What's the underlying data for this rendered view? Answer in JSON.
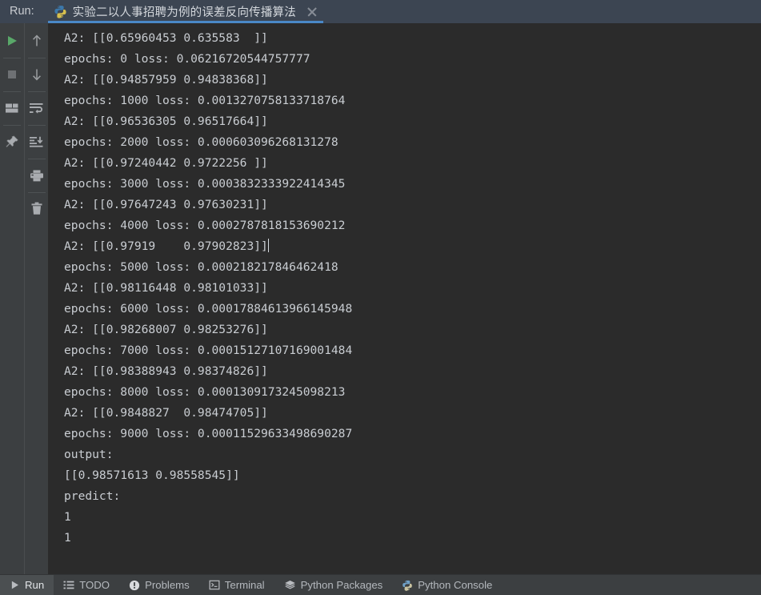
{
  "window": {
    "run_label": "Run:",
    "accent_color": "#4a88c7",
    "titlebar_bg": "#3c4552",
    "console_bg": "#2b2b2b",
    "console_fg": "#c9cdd2",
    "toolbar_bg": "#3c3f41"
  },
  "tab": {
    "title": "实验二以人事招聘为例的误差反向传播算法",
    "icon": "python-icon",
    "close_icon": "close-icon",
    "active": true
  },
  "left_toolbar": {
    "items": [
      {
        "name": "rerun-button",
        "icon": "play-icon",
        "color": "#59a869"
      },
      {
        "name": "stop-button",
        "icon": "stop-icon",
        "color": "#6e7174"
      },
      {
        "name": "layout-button",
        "icon": "layout-icon",
        "color": "#a9acb0"
      },
      {
        "name": "pin-button",
        "icon": "pin-icon",
        "color": "#a9acb0"
      }
    ]
  },
  "right_toolbar": {
    "items": [
      {
        "name": "previous-occurrence-button",
        "icon": "arrow-up-icon"
      },
      {
        "name": "next-occurrence-button",
        "icon": "arrow-down-icon"
      },
      {
        "name": "soft-wrap-button",
        "icon": "soft-wrap-icon"
      },
      {
        "name": "scroll-to-end-button",
        "icon": "scroll-to-end-icon"
      },
      {
        "name": "print-button",
        "icon": "print-icon"
      },
      {
        "name": "clear-all-button",
        "icon": "trash-icon"
      }
    ]
  },
  "console": {
    "lines": [
      "A2: [[0.65960453 0.635583  ]]",
      "epochs: 0 loss: 0.06216720544757777",
      "A2: [[0.94857959 0.94838368]]",
      "epochs: 1000 loss: 0.0013270758133718764",
      "A2: [[0.96536305 0.96517664]]",
      "epochs: 2000 loss: 0.000603096268131278",
      "A2: [[0.97240442 0.9722256 ]]",
      "epochs: 3000 loss: 0.0003832333922414345",
      "A2: [[0.97647243 0.97630231]]",
      "epochs: 4000 loss: 0.0002787818153690212",
      "A2: [[0.97919    0.97902823]]",
      "epochs: 5000 loss: 0.000218217846462418",
      "A2: [[0.98116448 0.98101033]]",
      "epochs: 6000 loss: 0.00017884613966145948",
      "A2: [[0.98268007 0.98253276]]",
      "epochs: 7000 loss: 0.00015127107169001484",
      "A2: [[0.98388943 0.98374826]]",
      "epochs: 8000 loss: 0.0001309173245098213",
      "A2: [[0.9848827  0.98474705]]",
      "epochs: 9000 loss: 0.00011529633498690287",
      "output:",
      "[[0.98571613 0.98558545]]",
      "predict:",
      "1",
      "1"
    ],
    "caret_line_index": 10
  },
  "statusbar": {
    "items": [
      {
        "label": "Run",
        "icon": "play-icon",
        "active": true
      },
      {
        "label": "TODO",
        "icon": "list-icon",
        "active": false
      },
      {
        "label": "Problems",
        "icon": "warning-icon",
        "active": false
      },
      {
        "label": "Terminal",
        "icon": "terminal-icon",
        "active": false
      },
      {
        "label": "Python Packages",
        "icon": "layers-icon",
        "active": false
      },
      {
        "label": "Python Console",
        "icon": "python-icon",
        "active": false
      }
    ]
  }
}
